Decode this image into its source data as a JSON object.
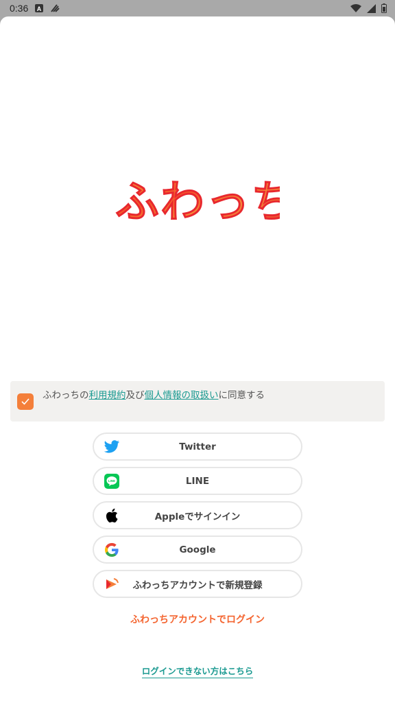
{
  "status_bar": {
    "time": "0:36",
    "icons_left": [
      "a-icon",
      "app-notification-icon"
    ],
    "icons_right": [
      "wifi-icon",
      "signal-icon",
      "battery-icon"
    ]
  },
  "app": {
    "logo_text": "ふわっち",
    "brand_colors": {
      "orange": "#f47f3a",
      "red": "#e8282e",
      "teal": "#1b9a91"
    }
  },
  "consent": {
    "checked": true,
    "prefix": "ふわっちの",
    "terms_link": "利用規約",
    "and": "及び",
    "privacy_link": "個人情報の取扱い",
    "suffix": "に同意する"
  },
  "buttons": {
    "twitter": "Twitter",
    "line": "LINE",
    "apple": "Appleでサインイン",
    "google": "Google",
    "register": "ふわっちアカウントで新規登録"
  },
  "login_link": "ふわっちアカウントでログイン",
  "cant_login_link": "ログインできない方はこちら"
}
